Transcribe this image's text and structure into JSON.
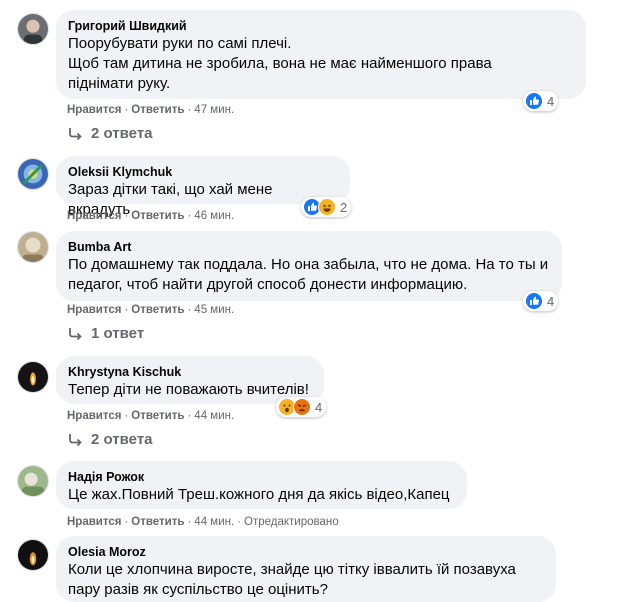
{
  "comments": [
    {
      "author": "Григорий Швидкий",
      "lines": [
        "Поорубувати руки по самі плечі.",
        "Щоб там дитина не зробила, вона не має найменшого права",
        "піднімати руку."
      ],
      "like": "Нравится",
      "reply": "Ответить",
      "time": "47 мин.",
      "reaction_count": "4",
      "reactions": [
        "like"
      ],
      "replies": "2 ответа"
    },
    {
      "author": "Oleksii Klymchuk",
      "lines": [
        "Зараз дітки такі, що хай мене вкрадуть"
      ],
      "like": "Нравится",
      "reply": "Ответить",
      "time": "46 мин.",
      "reaction_count": "2",
      "reactions": [
        "like",
        "haha"
      ],
      "replies": ""
    },
    {
      "author": "Bumba Art",
      "lines": [
        "По домашнему так поддала. Но она забыла, что не дома. На то ты и",
        "педагог, чтоб найти другой способ донести информацию."
      ],
      "like": "Нравится",
      "reply": "Ответить",
      "time": "45 мин.",
      "reaction_count": "4",
      "reactions": [
        "like"
      ],
      "replies": "1 ответ"
    },
    {
      "author": "Khrystyna Kischuk",
      "lines": [
        "Тепер діти не поважають вчителів!"
      ],
      "like": "Нравится",
      "reply": "Ответить",
      "time": "44 мин.",
      "reaction_count": "4",
      "reactions": [
        "wow",
        "angry"
      ],
      "replies": "2 ответа"
    },
    {
      "author": "Надія Рожок",
      "lines": [
        "Це жах.Повний Треш.кожного дня да якісь відео,Капец"
      ],
      "like": "Нравится",
      "reply": "Ответить",
      "time": "44 мин.",
      "edited": "Отредактировано",
      "reaction_count": "",
      "reactions": [],
      "replies": ""
    },
    {
      "author": "Olesia Moroz",
      "lines": [
        "Коли це хлопчина виросте, знайде цю тітку іввалить їй позавуха",
        "пару разів як суспільство це оцінить?"
      ],
      "like": "",
      "reply": "",
      "time": "",
      "reaction_count": "",
      "reactions": [],
      "replies": ""
    }
  ],
  "colors": {
    "bubble": "#f0f2f5",
    "meta": "#65676b",
    "like_blue": "#1877f2"
  },
  "icons": {
    "reply_arrow": "reply-arrow-icon",
    "like": "like-reaction-icon",
    "haha": "haha-reaction-icon",
    "wow": "wow-reaction-icon",
    "angry": "angry-reaction-icon"
  }
}
